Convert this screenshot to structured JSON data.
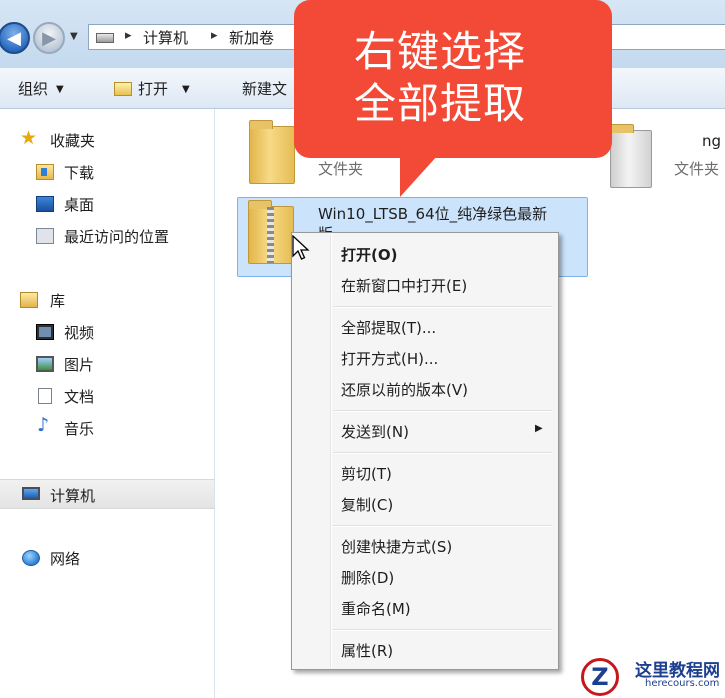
{
  "address_bar": {
    "breadcrumbs": [
      "计算机",
      "新加卷"
    ]
  },
  "command_bar": {
    "organize_label": "组织",
    "open_label": "打开",
    "new_label": "新建文"
  },
  "nav_pane": {
    "favorites_header": "收藏夹",
    "favorites": [
      "下载",
      "桌面",
      "最近访问的位置"
    ],
    "libraries_header": "库",
    "libraries": [
      "视频",
      "图片",
      "文档",
      "音乐"
    ],
    "computer_label": "计算机",
    "network_label": "网络"
  },
  "content": {
    "folder1_type": "文件夹",
    "folder3_name_fragment": "ng",
    "folder3_type": "文件夹",
    "selected_file_line1": "Win10_LTSB_64位_纯净绿色最新",
    "selected_file_line2": "版"
  },
  "callout": {
    "line1": "右键选择",
    "line2": "全部提取",
    "color": "#f24a36"
  },
  "context_menu": {
    "items": [
      "打开(O)",
      "在新窗口中打开(E)",
      "全部提取(T)...",
      "打开方式(H)...",
      "还原以前的版本(V)",
      "发送到(N)",
      "剪切(T)",
      "复制(C)",
      "创建快捷方式(S)",
      "删除(D)",
      "重命名(M)",
      "属性(R)"
    ]
  },
  "watermark": {
    "logo_letter": "Z",
    "title": "这里教程网",
    "url": "herecours.com"
  }
}
